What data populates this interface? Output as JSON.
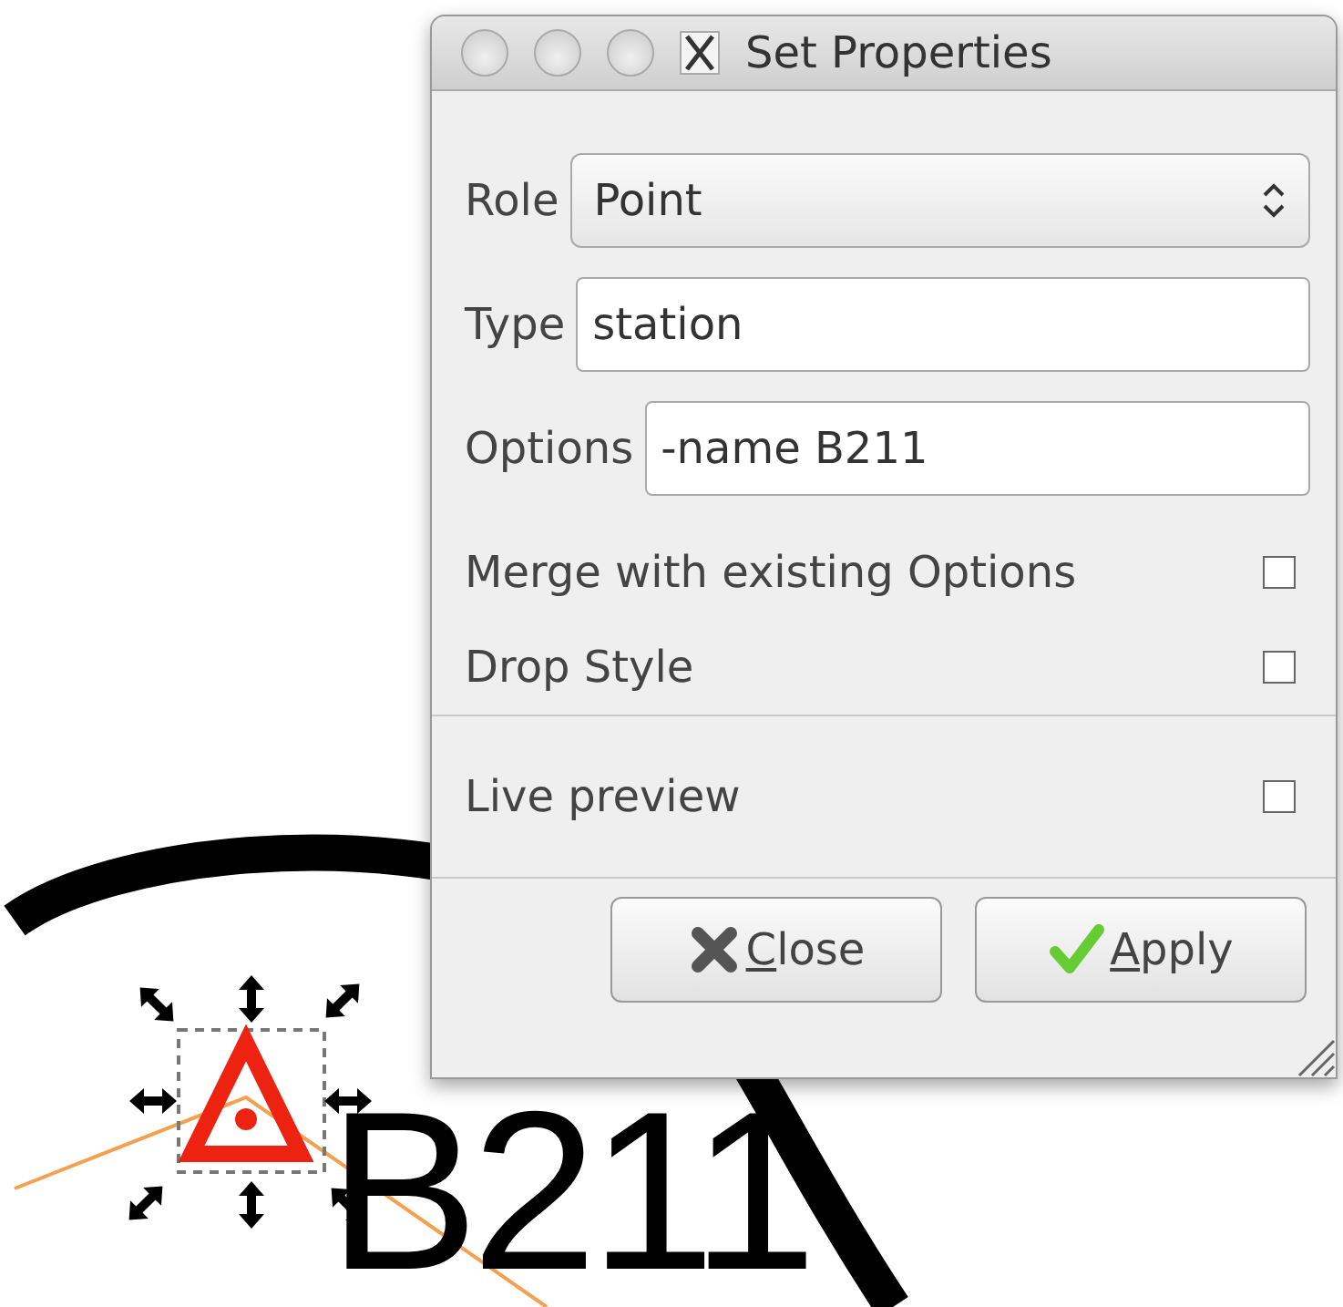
{
  "window": {
    "title": "Set Properties"
  },
  "fields": [
    {
      "label": "Role",
      "kind": "select",
      "value": "Point"
    },
    {
      "label": "Type",
      "kind": "text",
      "value": "station"
    },
    {
      "label": "Options",
      "kind": "text",
      "value": "-name B211"
    }
  ],
  "options": [
    {
      "label": "Merge with existing Options",
      "checked": false
    },
    {
      "label": "Drop Style",
      "checked": false
    }
  ],
  "live_preview": {
    "label": "Live preview",
    "checked": false
  },
  "buttons": [
    {
      "label": "Close",
      "kind": "close"
    },
    {
      "label": "Apply",
      "kind": "apply"
    }
  ],
  "canvas": {
    "label": "B211"
  }
}
